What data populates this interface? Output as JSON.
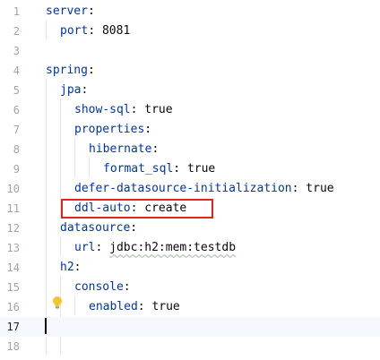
{
  "editor": {
    "accent_color": "#0033b3",
    "highlight_color": "#e8201e",
    "lines": [
      {
        "num": "1",
        "key": "server",
        "sep": ":",
        "val": ""
      },
      {
        "num": "2",
        "key": "port",
        "sep": ": ",
        "val": "8081"
      },
      {
        "num": "3",
        "key": "",
        "sep": "",
        "val": ""
      },
      {
        "num": "4",
        "key": "spring",
        "sep": ":",
        "val": ""
      },
      {
        "num": "5",
        "key": "jpa",
        "sep": ":",
        "val": ""
      },
      {
        "num": "6",
        "key": "show-sql",
        "sep": ": ",
        "val": "true"
      },
      {
        "num": "7",
        "key": "properties",
        "sep": ":",
        "val": ""
      },
      {
        "num": "8",
        "key": "hibernate",
        "sep": ":",
        "val": ""
      },
      {
        "num": "9",
        "key": "format_sql",
        "sep": ": ",
        "val": "true"
      },
      {
        "num": "10",
        "key": "defer-datasource-initialization",
        "sep": ": ",
        "val": "true"
      },
      {
        "num": "11",
        "key": "ddl-auto",
        "sep": ": ",
        "val": "create"
      },
      {
        "num": "12",
        "key": "datasource",
        "sep": ":",
        "val": ""
      },
      {
        "num": "13",
        "key": "url",
        "sep": ": ",
        "val": "jdbc:h2:mem:testdb"
      },
      {
        "num": "14",
        "key": "h2",
        "sep": ":",
        "val": ""
      },
      {
        "num": "15",
        "key": "console",
        "sep": ":",
        "val": ""
      },
      {
        "num": "16",
        "key": "enabled",
        "sep": ": ",
        "val": "true"
      },
      {
        "num": "17",
        "key": "",
        "sep": "",
        "val": ""
      },
      {
        "num": "18",
        "key": "",
        "sep": "",
        "val": ""
      }
    ]
  },
  "icons": {
    "intention_bulb": "lightbulb-icon",
    "caret": "text-caret"
  }
}
